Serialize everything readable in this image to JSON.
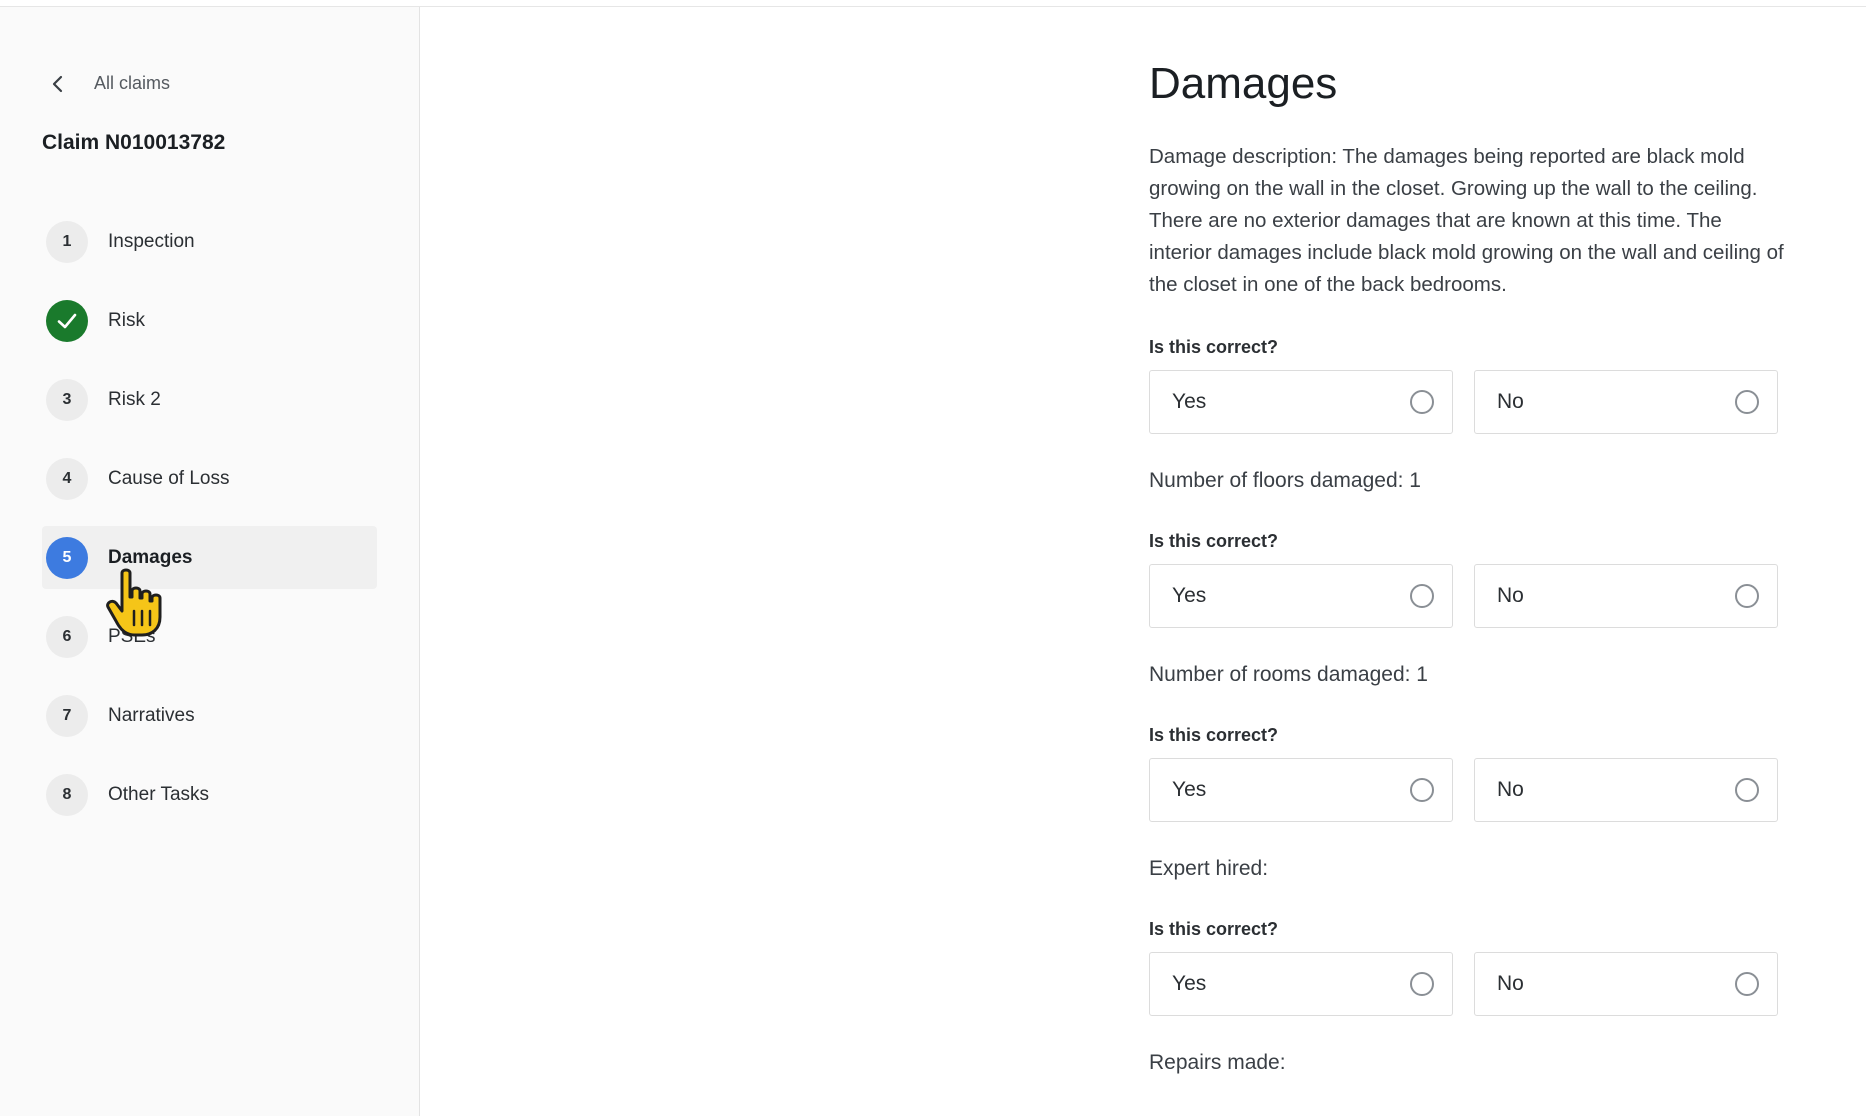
{
  "sidebar": {
    "back_label": "All claims",
    "claim_title": "Claim N010013782",
    "steps": [
      {
        "badge": "1",
        "label": "Inspection",
        "state": "todo"
      },
      {
        "badge": "",
        "label": "Risk",
        "state": "done"
      },
      {
        "badge": "3",
        "label": "Risk 2",
        "state": "todo"
      },
      {
        "badge": "4",
        "label": "Cause of Loss",
        "state": "todo"
      },
      {
        "badge": "5",
        "label": "Damages",
        "state": "current"
      },
      {
        "badge": "6",
        "label": "PSEs",
        "state": "todo"
      },
      {
        "badge": "7",
        "label": "Narratives",
        "state": "todo"
      },
      {
        "badge": "8",
        "label": "Other Tasks",
        "state": "todo"
      }
    ]
  },
  "main": {
    "title": "Damages",
    "description": "Damage description: The damages being reported are black mold growing on the wall in the closet. Growing up the wall to the ceiling. There are no exterior damages that are known at this time. The interior damages include black mold growing on the wall and ceiling of the closet in one of the back bedrooms.",
    "question_label": "Is this correct?",
    "yes_label": "Yes",
    "no_label": "No",
    "facts": [
      "Number of floors damaged: 1",
      "Number of rooms damaged: 1",
      "Expert hired:",
      "Repairs made:"
    ]
  },
  "colors": {
    "done": "#1a7a2c",
    "current": "#3d7be0",
    "cursor": "#f5c518"
  },
  "icons": {
    "back": "chevron-left-icon",
    "done": "checkmark-icon",
    "radio": "radio-empty-icon",
    "cursor": "hand-pointer-icon"
  }
}
